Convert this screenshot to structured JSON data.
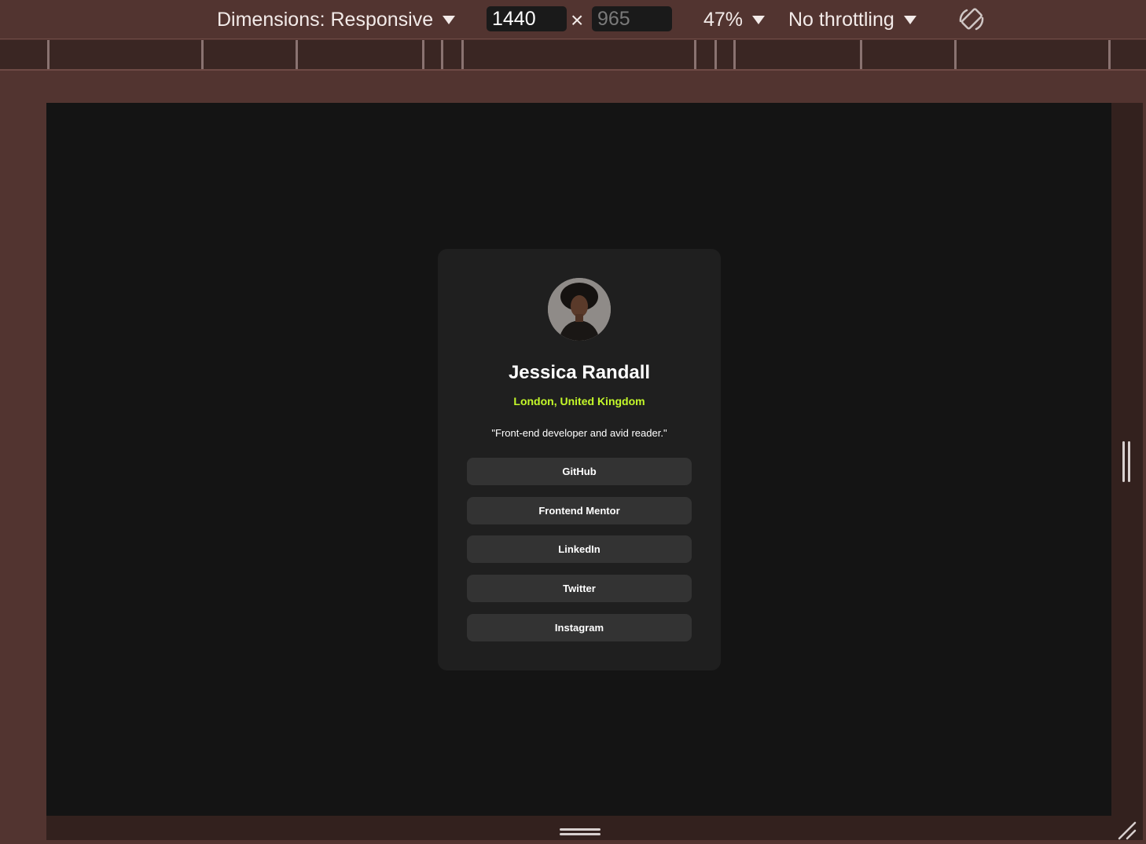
{
  "toolbar": {
    "dimensions_label": "Dimensions: Responsive",
    "width_value": "1440",
    "height_value": "965",
    "times_symbol": "×",
    "zoom_label": "47%",
    "throttling_label": "No throttling",
    "rotate_icon": "rotate-device-icon"
  },
  "profile": {
    "name": "Jessica Randall",
    "location": "London, United Kingdom",
    "bio": "\"Front-end developer and avid reader.\"",
    "avatar_icon": "avatar-photo",
    "links": [
      {
        "label": "GitHub"
      },
      {
        "label": "Frontend Mentor"
      },
      {
        "label": "LinkedIn"
      },
      {
        "label": "Twitter"
      },
      {
        "label": "Instagram"
      }
    ]
  },
  "colors": {
    "devtools_bg": "#523430",
    "viewport_bg": "#141414",
    "card_bg": "#1f1f1f",
    "button_bg": "#333333",
    "accent": "#c4f82a"
  }
}
